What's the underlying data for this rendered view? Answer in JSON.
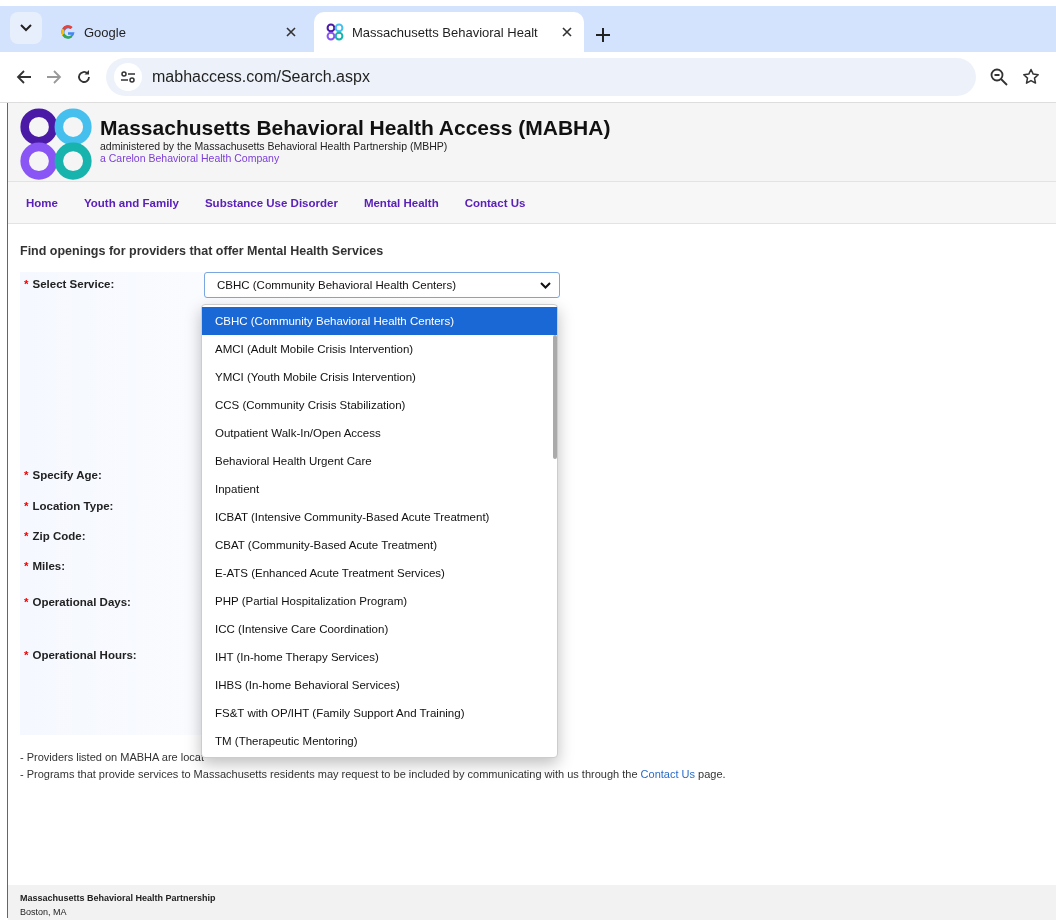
{
  "browser": {
    "tabs": [
      {
        "title": "Google",
        "selected": false
      },
      {
        "title": "Massachusetts Behavioral Healt",
        "selected": true
      }
    ],
    "url": "mabhaccess.com/Search.aspx"
  },
  "header": {
    "title": "Massachusetts Behavioral Health Access (MABHA)",
    "subtitle": "administered by the Massachusetts Behavioral Health Partnership (MBHP)",
    "company": "a Carelon Behavioral Health Company"
  },
  "nav": [
    "Home",
    "Youth and Family",
    "Substance Use Disorder",
    "Mental Health",
    "Contact Us"
  ],
  "heading": "Find openings for providers that offer Mental Health Services",
  "fields": [
    {
      "label": "Select Service:",
      "required_mark": "*",
      "kind": "select",
      "value": "CBHC (Community Behavioral Health Centers)"
    },
    {
      "label": "Specify Age:",
      "required_mark": "*",
      "kind": "hidden"
    },
    {
      "label": "Location Type:",
      "required_mark": "*",
      "kind": "hidden"
    },
    {
      "label": "Zip Code:",
      "required_mark": "*",
      "kind": "hidden"
    },
    {
      "label": "Miles:",
      "required_mark": "*",
      "kind": "hidden"
    },
    {
      "label": "Operational Days:",
      "required_mark": "*",
      "kind": "hidden"
    },
    {
      "label": "Operational Hours:",
      "required_mark": "*",
      "kind": "hidden"
    }
  ],
  "dropdown": {
    "options": [
      {
        "label": "CBHC (Community Behavioral Health Centers)",
        "selected": true
      },
      {
        "label": "AMCI (Adult Mobile Crisis Intervention)",
        "selected": false
      },
      {
        "label": "YMCI (Youth Mobile Crisis Intervention)",
        "selected": false
      },
      {
        "label": "CCS (Community Crisis Stabilization)",
        "selected": false
      },
      {
        "label": "Outpatient Walk-In/Open Access",
        "selected": false
      },
      {
        "label": "Behavioral Health Urgent Care",
        "selected": false
      },
      {
        "label": "Inpatient",
        "selected": false
      },
      {
        "label": "ICBAT (Intensive Community-Based Acute Treatment)",
        "selected": false
      },
      {
        "label": "CBAT (Community-Based Acute Treatment)",
        "selected": false
      },
      {
        "label": "E-ATS (Enhanced Acute Treatment Services)",
        "selected": false
      },
      {
        "label": "PHP (Partial Hospitalization Program)",
        "selected": false
      },
      {
        "label": "ICC (Intensive Care Coordination)",
        "selected": false
      },
      {
        "label": "IHT (In-home Therapy Services)",
        "selected": false
      },
      {
        "label": "IHBS (In-home Behavioral Services)",
        "selected": false
      },
      {
        "label": "FS&T with OP/IHT (Family Support And Training)",
        "selected": false
      },
      {
        "label": "TM (Therapeutic Mentoring)",
        "selected": false
      }
    ]
  },
  "notes": [
    {
      "text": "- Providers listed on MABHA are locat"
    },
    {
      "text": "- Programs that provide services to Massachusetts residents may request to be included by communicating with us through the ",
      "link": "Contact Us",
      "after": " page."
    }
  ],
  "footer": {
    "name": "Massachusetts Behavioral Health Partnership",
    "city": "Boston, MA"
  }
}
